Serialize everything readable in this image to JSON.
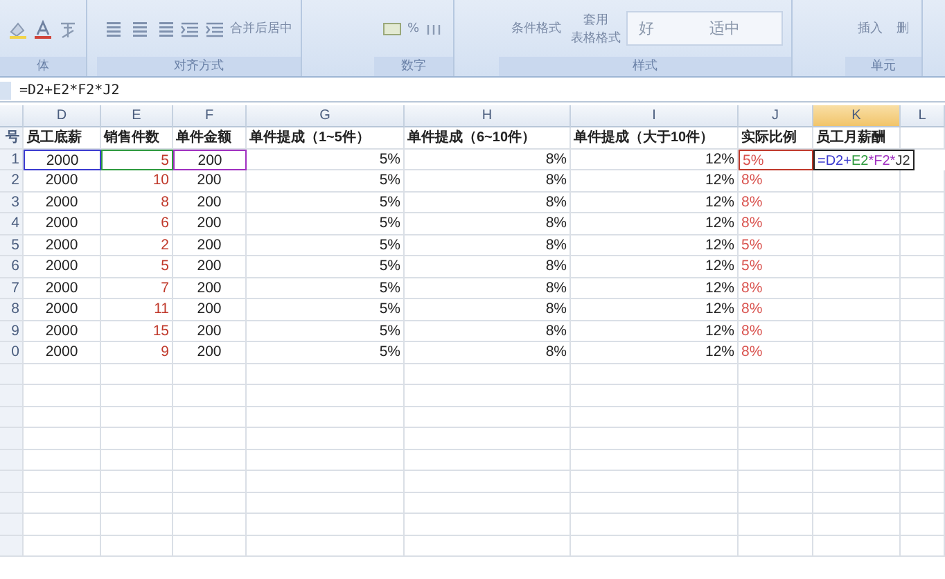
{
  "ribbon": {
    "groups": [
      {
        "kind": "font",
        "label": "体"
      },
      {
        "kind": "align",
        "label": "对齐方式",
        "merge_button": "合并后居中"
      },
      {
        "kind": "number",
        "label": "数字",
        "percent": "%"
      },
      {
        "kind": "styles",
        "label": "样式",
        "buttons": [
          "条件格式",
          "套用"
        ],
        "sub_label": "表格格式",
        "style_cells": [
          "好",
          "适中"
        ]
      },
      {
        "kind": "cells",
        "label": "单元",
        "buttons": [
          "插入",
          "删"
        ]
      }
    ]
  },
  "formula_bar": {
    "formula": "=D2+E2*F2*J2"
  },
  "sheet": {
    "columns": [
      {
        "header": "号",
        "selected": false
      },
      {
        "letter": "D",
        "header": "员工底薪",
        "selected": false
      },
      {
        "letter": "E",
        "header": "销售件数",
        "selected": false,
        "color": "#c0392b"
      },
      {
        "letter": "F",
        "header": "单件金额",
        "selected": false
      },
      {
        "letter": "G",
        "header": "单件提成（1~5件）",
        "selected": false
      },
      {
        "letter": "H",
        "header": "单件提成（6~10件）",
        "selected": false
      },
      {
        "letter": "I",
        "header": "单件提成（大于10件）",
        "selected": false
      },
      {
        "letter": "J",
        "header": "实际比例",
        "selected": false,
        "color": "#d9534f"
      },
      {
        "letter": "K",
        "header": "员工月薪酬",
        "selected": true
      },
      {
        "letter": "L",
        "selected": false
      }
    ],
    "rows": [
      {
        "cells": [
          "1",
          {
            "text": "2000",
            "color": "#3b3bd0"
          },
          {
            "text": "5",
            "color": "#2e9a3e"
          },
          {
            "text": "200",
            "color": "#a030c0"
          },
          "5%",
          "8%",
          "12%",
          {
            "text": "5%",
            "color": "#c0392b"
          }
        ],
        "formula_tokens": [
          {
            "text": "=D2",
            "color": "#3b3bd0"
          },
          {
            "text": "+",
            "color": "#3b3bd0"
          },
          {
            "text": "E2",
            "color": "#2e9a3e"
          },
          {
            "text": "*",
            "color": "#a030c0"
          },
          {
            "text": "F2",
            "color": "#a030c0"
          },
          {
            "text": "*",
            "color": "#a030c0"
          },
          {
            "text": "J2",
            "color": "#333333"
          }
        ]
      },
      {
        "cells": [
          "2",
          "2000",
          "10",
          "200",
          "5%",
          "8%",
          "12%",
          "8%"
        ]
      },
      {
        "cells": [
          "3",
          "2000",
          "8",
          "200",
          "5%",
          "8%",
          "12%",
          "8%"
        ]
      },
      {
        "cells": [
          "4",
          "2000",
          "6",
          "200",
          "5%",
          "8%",
          "12%",
          "8%"
        ]
      },
      {
        "cells": [
          "5",
          "2000",
          "2",
          "200",
          "5%",
          "8%",
          "12%",
          "5%"
        ]
      },
      {
        "cells": [
          "6",
          "2000",
          "5",
          "200",
          "5%",
          "8%",
          "12%",
          "5%"
        ]
      },
      {
        "cells": [
          "7",
          "2000",
          "7",
          "200",
          "5%",
          "8%",
          "12%",
          "8%"
        ]
      },
      {
        "cells": [
          "8",
          "2000",
          "11",
          "200",
          "5%",
          "8%",
          "12%",
          "8%"
        ]
      },
      {
        "cells": [
          "9",
          "2000",
          "15",
          "200",
          "5%",
          "8%",
          "12%",
          "8%"
        ]
      },
      {
        "cells": [
          "0",
          "2000",
          "9",
          "200",
          "5%",
          "8%",
          "12%",
          "8%"
        ]
      }
    ]
  }
}
